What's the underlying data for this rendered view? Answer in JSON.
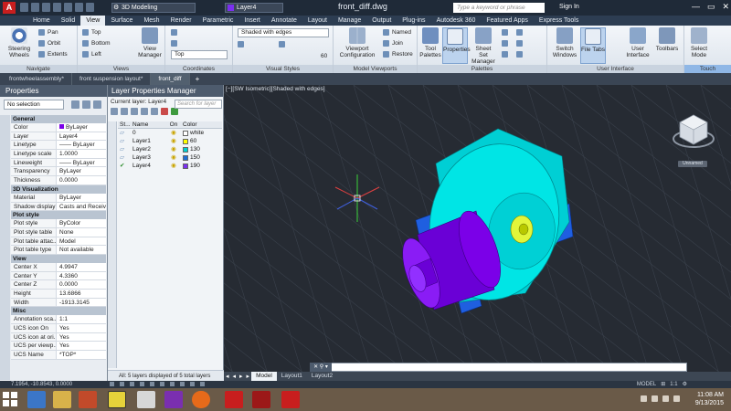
{
  "titlebar": {
    "app_letter": "A",
    "workspace": "3D Modeling",
    "current_layer": "Layer4",
    "doc_title": "front_diff.dwg",
    "search_placeholder": "Type a keyword or phrase",
    "sign_in": "Sign In",
    "window_buttons": [
      "—",
      "▭",
      "✕"
    ]
  },
  "ribbon_tabs": [
    "Home",
    "Solid",
    "View",
    "Surface",
    "Mesh",
    "Render",
    "Parametric",
    "Insert",
    "Annotate",
    "Layout",
    "Manage",
    "Output",
    "Plug-ins",
    "Autodesk 360",
    "Featured Apps",
    "Express Tools"
  ],
  "ribbon_active_tab": "View",
  "ribbon": {
    "navigate": {
      "title": "Navigate",
      "steering": "Steering Wheels",
      "pan": "Pan",
      "orbit": "Orbit",
      "extents": "Extents"
    },
    "views": {
      "title": "Views",
      "items": [
        "Top",
        "Bottom",
        "Left"
      ],
      "manager": "View Manager"
    },
    "coordinates": {
      "title": "Coordinates",
      "ucs": "Top"
    },
    "visual_styles": {
      "title": "Visual Styles",
      "style": "Shaded with edges",
      "value": "60"
    },
    "model_viewports": {
      "title": "Model Viewports",
      "config": "Viewport Configuration",
      "named": "Named",
      "join": "Join",
      "restore": "Restore"
    },
    "palettes": {
      "title": "Palettes",
      "tool": "Tool Palettes",
      "properties": "Properties",
      "sheet_set": "Sheet Set Manager"
    },
    "user_interface": {
      "title": "User Interface",
      "switch": "Switch Windows",
      "file_tabs": "File Tabs",
      "user_iface": "User Interface",
      "toolbars": "Toolbars"
    },
    "touch": {
      "title": "Touch",
      "select": "Select Mode"
    }
  },
  "doc_tabs": [
    "frontwheelassembly*",
    "front suspension layout*",
    "front_diff"
  ],
  "doc_tab_active": "front_diff",
  "properties": {
    "title": "Properties",
    "selection": "No selection",
    "sections": [
      {
        "name": "General",
        "rows": [
          {
            "k": "Color",
            "v": "ByLayer"
          },
          {
            "k": "Layer",
            "v": "Layer4"
          },
          {
            "k": "Linetype",
            "v": "—— ByLayer"
          },
          {
            "k": "Linetype scale",
            "v": "1.0000"
          },
          {
            "k": "Lineweight",
            "v": "—— ByLayer"
          },
          {
            "k": "Transparency",
            "v": "ByLayer"
          },
          {
            "k": "Thickness",
            "v": "0.0000"
          }
        ]
      },
      {
        "name": "3D Visualization",
        "rows": [
          {
            "k": "Material",
            "v": "ByLayer"
          },
          {
            "k": "Shadow display",
            "v": "Casts and Receives"
          }
        ]
      },
      {
        "name": "Plot style",
        "rows": [
          {
            "k": "Plot style",
            "v": "ByColor"
          },
          {
            "k": "Plot style table",
            "v": "None"
          },
          {
            "k": "Plot table attac...",
            "v": "Model"
          },
          {
            "k": "Plot table type",
            "v": "Not available"
          }
        ]
      },
      {
        "name": "View",
        "rows": [
          {
            "k": "Center X",
            "v": "4.9947"
          },
          {
            "k": "Center Y",
            "v": "4.3360"
          },
          {
            "k": "Center Z",
            "v": "0.0000"
          },
          {
            "k": "Height",
            "v": "13.6866"
          },
          {
            "k": "Width",
            "v": "-1913.3145"
          }
        ]
      },
      {
        "name": "Misc",
        "rows": [
          {
            "k": "Annotation sca...",
            "v": "1:1"
          },
          {
            "k": "UCS icon On",
            "v": "Yes"
          },
          {
            "k": "UCS icon at ori...",
            "v": "Yes"
          },
          {
            "k": "UCS per viewp...",
            "v": "Yes"
          },
          {
            "k": "UCS Name",
            "v": "*TOP*"
          }
        ]
      }
    ]
  },
  "layer_manager": {
    "title": "Layer Properties Manager",
    "current": "Current layer: Layer4",
    "search_placeholder": "Search for layer",
    "headers": [
      "St...",
      "Name",
      "On",
      "Color"
    ],
    "layers": [
      {
        "status": "▱",
        "name": "0",
        "on": "💡",
        "color": "#ffffff",
        "color_name": "white"
      },
      {
        "status": "▱",
        "name": "Layer1",
        "on": "💡",
        "color": "#ffff00",
        "color_name": "60"
      },
      {
        "status": "▱",
        "name": "Layer2",
        "on": "💡",
        "color": "#00d0d0",
        "color_name": "130"
      },
      {
        "status": "▱",
        "name": "Layer3",
        "on": "💡",
        "color": "#1e6fd6",
        "color_name": "150"
      },
      {
        "status": "✔",
        "name": "Layer4",
        "on": "💡",
        "color": "#7b2ff0",
        "color_name": "190"
      }
    ],
    "footer": "All: 5 layers displayed of 5 total layers"
  },
  "viewport": {
    "label": "[−][SW Isometric][Shaded with edges]",
    "viewcube_label": "Unnamed"
  },
  "layout_tabs": [
    "Model",
    "Layout1",
    "Layout2"
  ],
  "layout_active": "Model",
  "statusbar": {
    "coords": "7.1954, -10.8543, 0.0000",
    "right_items": [
      "MODEL",
      "⊞",
      "1:1",
      "⚙"
    ]
  },
  "taskbar": {
    "time": "11:08 AM",
    "date": "9/13/2015"
  },
  "colors": {
    "accent": "#2d3d52",
    "cyan_solid": "#00e5e5",
    "purple_solid": "#7b00e8",
    "blue_solid": "#1f5fe0",
    "yellow_solid": "#f2ff00"
  }
}
